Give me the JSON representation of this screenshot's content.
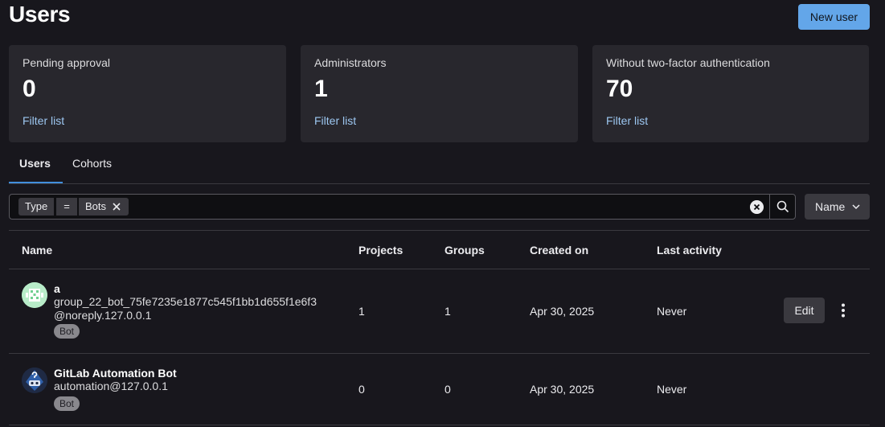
{
  "header": {
    "title": "Users",
    "new_user_label": "New user"
  },
  "stats": [
    {
      "label": "Pending approval",
      "value": "0",
      "link": "Filter list"
    },
    {
      "label": "Administrators",
      "value": "1",
      "link": "Filter list"
    },
    {
      "label": "Without two-factor authentication",
      "value": "70",
      "link": "Filter list"
    }
  ],
  "tabs": [
    {
      "label": "Users",
      "active": true
    },
    {
      "label": "Cohorts",
      "active": false
    }
  ],
  "filter": {
    "token_type": "Type",
    "token_operator": "=",
    "token_value": "Bots"
  },
  "sort": {
    "selected": "Name"
  },
  "table": {
    "columns": [
      "Name",
      "Projects",
      "Groups",
      "Created on",
      "Last activity"
    ],
    "rows": [
      {
        "name": "a",
        "email_line1": "group_22_bot_75fe7235e1877c545f1bb1d655f1e6f3",
        "email_line2": "@noreply.127.0.0.1",
        "badge": "Bot",
        "projects": "1",
        "groups": "1",
        "created_on": "Apr 30, 2025",
        "last_activity": "Never",
        "edit_label": "Edit"
      },
      {
        "name": "GitLab Automation Bot",
        "email_line1": "automation@127.0.0.1",
        "badge": "Bot",
        "projects": "0",
        "groups": "0",
        "created_on": "Apr 30, 2025",
        "last_activity": "Never"
      }
    ]
  },
  "colors": {
    "background": "#18171d",
    "card": "#28272d",
    "primary_button": "#63a6e9",
    "link": "#9dc7f1",
    "active_tab": "#428fdc"
  }
}
